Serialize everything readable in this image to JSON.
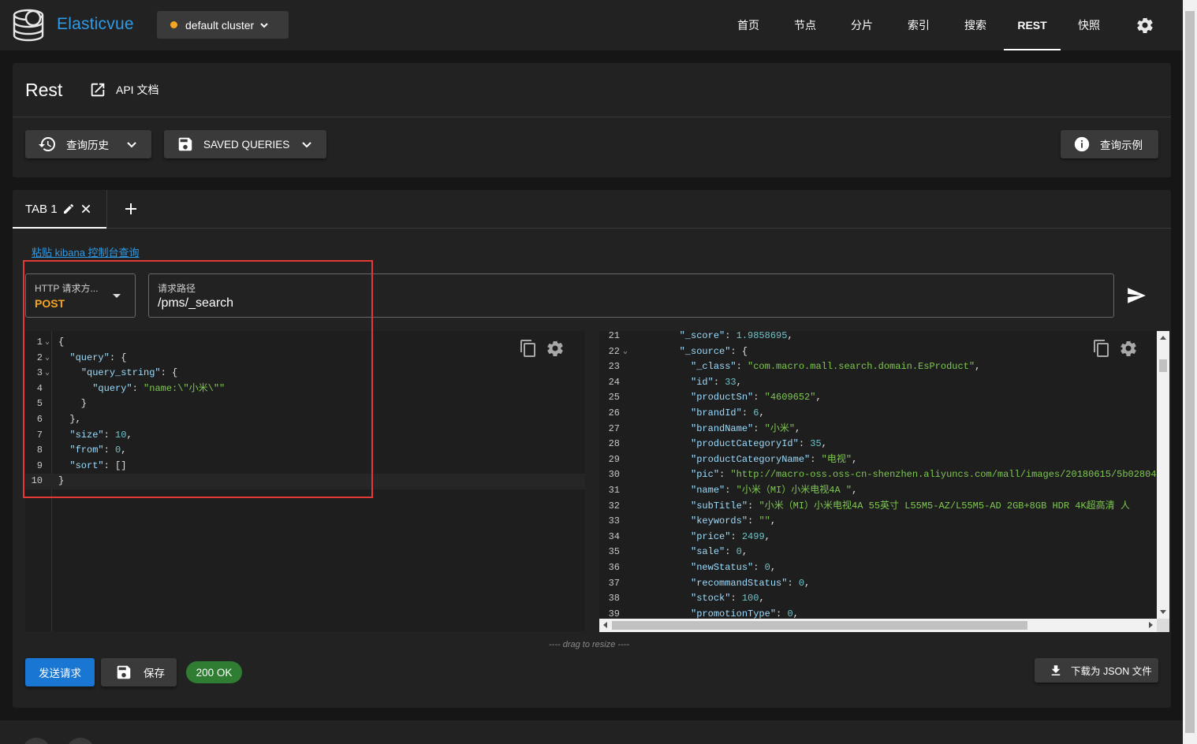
{
  "app": {
    "name": "Elasticvue",
    "cluster_label": "default cluster",
    "colors": {
      "brand": "#2f9be6",
      "cluster_dot": "#f5a623",
      "primary": "#1976d2",
      "success": "#2e7d32",
      "highlight_box": "#e53935"
    }
  },
  "nav": {
    "items": [
      {
        "label": "首页"
      },
      {
        "label": "节点"
      },
      {
        "label": "分片"
      },
      {
        "label": "索引"
      },
      {
        "label": "搜索"
      },
      {
        "label": "REST",
        "active": true
      },
      {
        "label": "快照"
      }
    ],
    "settings_icon": "gear-icon"
  },
  "header": {
    "title": "Rest",
    "api_docs_label": "API 文档",
    "history_label": "查询历史",
    "saved_queries_label": "SAVED QUERIES",
    "examples_label": "查询示例"
  },
  "tabs": {
    "items": [
      {
        "label": "TAB 1"
      }
    ]
  },
  "request": {
    "paste_link": "粘贴 kibana 控制台查询",
    "method_label": "HTTP 请求方...",
    "method_value": "POST",
    "path_label": "请求路径",
    "path_value": "/pms/_search"
  },
  "request_body": [
    {
      "num": "1",
      "fold": "⌄",
      "tokens": [
        [
          "p",
          "{"
        ]
      ]
    },
    {
      "num": "2",
      "fold": "⌄",
      "tokens": [
        [
          "p",
          "  "
        ],
        [
          "k",
          "\"query\""
        ],
        [
          "p",
          ": {"
        ]
      ]
    },
    {
      "num": "3",
      "fold": "⌄",
      "tokens": [
        [
          "p",
          "    "
        ],
        [
          "k",
          "\"query_string\""
        ],
        [
          "p",
          ": {"
        ]
      ]
    },
    {
      "num": "4",
      "fold": "",
      "tokens": [
        [
          "p",
          "      "
        ],
        [
          "k",
          "\"query\""
        ],
        [
          "p",
          ": "
        ],
        [
          "s",
          "\"name:\\\"小米\\\"\""
        ]
      ]
    },
    {
      "num": "5",
      "fold": "",
      "tokens": [
        [
          "p",
          "    }"
        ]
      ]
    },
    {
      "num": "6",
      "fold": "",
      "tokens": [
        [
          "p",
          "  },"
        ]
      ]
    },
    {
      "num": "7",
      "fold": "",
      "tokens": [
        [
          "p",
          "  "
        ],
        [
          "k",
          "\"size\""
        ],
        [
          "p",
          ": "
        ],
        [
          "n",
          "10"
        ],
        [
          "p",
          ","
        ]
      ]
    },
    {
      "num": "8",
      "fold": "",
      "tokens": [
        [
          "p",
          "  "
        ],
        [
          "k",
          "\"from\""
        ],
        [
          "p",
          ": "
        ],
        [
          "n",
          "0"
        ],
        [
          "p",
          ","
        ]
      ]
    },
    {
      "num": "9",
      "fold": "",
      "tokens": [
        [
          "p",
          "  "
        ],
        [
          "k",
          "\"sort\""
        ],
        [
          "p",
          ": []"
        ]
      ]
    },
    {
      "num": "10",
      "fold": "",
      "tokens": [
        [
          "p",
          "}"
        ]
      ],
      "current": true
    }
  ],
  "response_body": [
    {
      "num": "21",
      "fold": "",
      "tokens": [
        [
          "p",
          "        "
        ],
        [
          "k",
          "\"_score\""
        ],
        [
          "p",
          ": "
        ],
        [
          "n",
          "1.9858695"
        ],
        [
          "p",
          ","
        ]
      ]
    },
    {
      "num": "22",
      "fold": "⌄",
      "tokens": [
        [
          "p",
          "        "
        ],
        [
          "k",
          "\"_source\""
        ],
        [
          "p",
          ": {"
        ]
      ]
    },
    {
      "num": "23",
      "fold": "",
      "tokens": [
        [
          "p",
          "          "
        ],
        [
          "k",
          "\"_class\""
        ],
        [
          "p",
          ": "
        ],
        [
          "s",
          "\"com.macro.mall.search.domain.EsProduct\""
        ],
        [
          "p",
          ","
        ]
      ]
    },
    {
      "num": "24",
      "fold": "",
      "tokens": [
        [
          "p",
          "          "
        ],
        [
          "k",
          "\"id\""
        ],
        [
          "p",
          ": "
        ],
        [
          "n",
          "33"
        ],
        [
          "p",
          ","
        ]
      ]
    },
    {
      "num": "25",
      "fold": "",
      "tokens": [
        [
          "p",
          "          "
        ],
        [
          "k",
          "\"productSn\""
        ],
        [
          "p",
          ": "
        ],
        [
          "s",
          "\"4609652\""
        ],
        [
          "p",
          ","
        ]
      ]
    },
    {
      "num": "26",
      "fold": "",
      "tokens": [
        [
          "p",
          "          "
        ],
        [
          "k",
          "\"brandId\""
        ],
        [
          "p",
          ": "
        ],
        [
          "n",
          "6"
        ],
        [
          "p",
          ","
        ]
      ]
    },
    {
      "num": "27",
      "fold": "",
      "tokens": [
        [
          "p",
          "          "
        ],
        [
          "k",
          "\"brandName\""
        ],
        [
          "p",
          ": "
        ],
        [
          "s",
          "\"小米\""
        ],
        [
          "p",
          ","
        ]
      ]
    },
    {
      "num": "28",
      "fold": "",
      "tokens": [
        [
          "p",
          "          "
        ],
        [
          "k",
          "\"productCategoryId\""
        ],
        [
          "p",
          ": "
        ],
        [
          "n",
          "35"
        ],
        [
          "p",
          ","
        ]
      ]
    },
    {
      "num": "29",
      "fold": "",
      "tokens": [
        [
          "p",
          "          "
        ],
        [
          "k",
          "\"productCategoryName\""
        ],
        [
          "p",
          ": "
        ],
        [
          "s",
          "\"电视\""
        ],
        [
          "p",
          ","
        ]
      ]
    },
    {
      "num": "30",
      "fold": "",
      "tokens": [
        [
          "p",
          "          "
        ],
        [
          "k",
          "\"pic\""
        ],
        [
          "p",
          ": "
        ],
        [
          "s",
          "\"http://macro-oss.oss-cn-shenzhen.aliyuncs.com/mall/images/20180615/5b02804"
        ]
      ]
    },
    {
      "num": "31",
      "fold": "",
      "tokens": [
        [
          "p",
          "          "
        ],
        [
          "k",
          "\"name\""
        ],
        [
          "p",
          ": "
        ],
        [
          "s",
          "\"小米（MI）小米电视4A \""
        ],
        [
          "p",
          ","
        ]
      ]
    },
    {
      "num": "32",
      "fold": "",
      "tokens": [
        [
          "p",
          "          "
        ],
        [
          "k",
          "\"subTitle\""
        ],
        [
          "p",
          ": "
        ],
        [
          "s",
          "\"小米（MI）小米电视4A 55英寸 L55M5-AZ/L55M5-AD 2GB+8GB HDR 4K超高清 人"
        ]
      ]
    },
    {
      "num": "33",
      "fold": "",
      "tokens": [
        [
          "p",
          "          "
        ],
        [
          "k",
          "\"keywords\""
        ],
        [
          "p",
          ": "
        ],
        [
          "s",
          "\"\""
        ],
        [
          "p",
          ","
        ]
      ]
    },
    {
      "num": "34",
      "fold": "",
      "tokens": [
        [
          "p",
          "          "
        ],
        [
          "k",
          "\"price\""
        ],
        [
          "p",
          ": "
        ],
        [
          "n",
          "2499"
        ],
        [
          "p",
          ","
        ]
      ]
    },
    {
      "num": "35",
      "fold": "",
      "tokens": [
        [
          "p",
          "          "
        ],
        [
          "k",
          "\"sale\""
        ],
        [
          "p",
          ": "
        ],
        [
          "n",
          "0"
        ],
        [
          "p",
          ","
        ]
      ]
    },
    {
      "num": "36",
      "fold": "",
      "tokens": [
        [
          "p",
          "          "
        ],
        [
          "k",
          "\"newStatus\""
        ],
        [
          "p",
          ": "
        ],
        [
          "n",
          "0"
        ],
        [
          "p",
          ","
        ]
      ]
    },
    {
      "num": "37",
      "fold": "",
      "tokens": [
        [
          "p",
          "          "
        ],
        [
          "k",
          "\"recommandStatus\""
        ],
        [
          "p",
          ": "
        ],
        [
          "n",
          "0"
        ],
        [
          "p",
          ","
        ]
      ]
    },
    {
      "num": "38",
      "fold": "",
      "tokens": [
        [
          "p",
          "          "
        ],
        [
          "k",
          "\"stock\""
        ],
        [
          "p",
          ": "
        ],
        [
          "n",
          "100"
        ],
        [
          "p",
          ","
        ]
      ]
    },
    {
      "num": "39",
      "fold": "",
      "tokens": [
        [
          "p",
          "          "
        ],
        [
          "k",
          "\"promotionType\""
        ],
        [
          "p",
          ": "
        ],
        [
          "n",
          "0"
        ],
        [
          "p",
          ","
        ]
      ]
    }
  ],
  "actions": {
    "drag_hint": "---- drag to resize ----",
    "send_label": "发送请求",
    "save_label": "保存",
    "status": "200 OK",
    "download_label": "下载为 JSON 文件"
  }
}
